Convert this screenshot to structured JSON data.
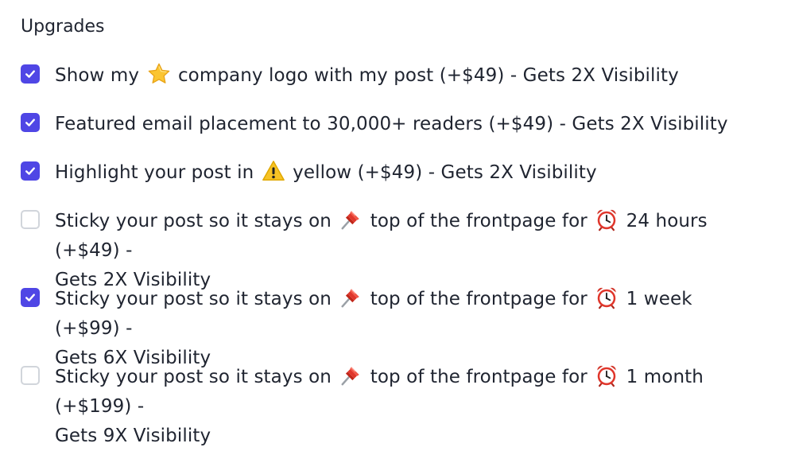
{
  "section_title": "Upgrades",
  "accent_color": "#4f46e5",
  "options": [
    {
      "checked": true,
      "text_before": "Show my",
      "icon": "star-icon",
      "text_after": "company logo with my post (+$49) - Gets 2X Visibility"
    },
    {
      "checked": true,
      "text": "Featured email placement to 30,000+ readers (+$49) - Gets 2X Visibility"
    },
    {
      "checked": true,
      "text_before": "Highlight your post in",
      "icon": "warning-icon",
      "text_after": "yellow (+$49) - Gets 2X Visibility"
    },
    {
      "checked": false,
      "text_1": "Sticky your post so it stays on",
      "icon_1": "pushpin-icon",
      "text_2": "top of the frontpage for",
      "icon_2": "alarm-clock-icon",
      "text_3": "24 hours (+$49) -",
      "text_4": "Gets 2X Visibility"
    },
    {
      "checked": true,
      "text_1": "Sticky your post so it stays on",
      "icon_1": "pushpin-icon",
      "text_2": "top of the frontpage for",
      "icon_2": "alarm-clock-icon",
      "text_3": "1 week (+$99) -",
      "text_4": "Gets 6X Visibility"
    },
    {
      "checked": false,
      "text_1": "Sticky your post so it stays on",
      "icon_1": "pushpin-icon",
      "text_2": "top of the frontpage for",
      "icon_2": "alarm-clock-icon",
      "text_3": "1 month (+$199) -",
      "text_4": "Gets 9X Visibility"
    }
  ]
}
